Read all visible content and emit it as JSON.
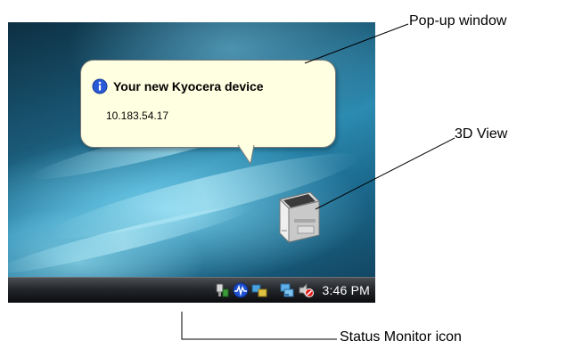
{
  "popup": {
    "title": "Your new Kyocera device",
    "text": "10.183.54.17"
  },
  "taskbar": {
    "clock": "3:46 PM",
    "tray_icons": [
      "safely-remove-hardware-icon",
      "status-monitor-icon",
      "network-icon",
      "network-connections-icon",
      "volume-muted-icon"
    ]
  },
  "callouts": {
    "popup_window": "Pop-up window",
    "view_3d": "3D View",
    "status_monitor_icon": "Status Monitor icon"
  },
  "colors": {
    "balloon_bg": "#ffffe1",
    "info_blue": "#2a5bd7",
    "taskbar": "#1c1e21"
  }
}
